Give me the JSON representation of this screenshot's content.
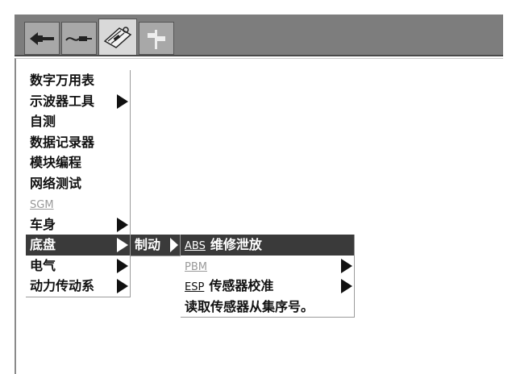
{
  "toolbar": {
    "tabs": [
      {
        "icon": "plug-connector-icon"
      },
      {
        "icon": "probe-cable-icon"
      },
      {
        "icon": "toolbox-wrench-icon",
        "active": true
      },
      {
        "icon": "signpost-icon"
      }
    ]
  },
  "main_menu": {
    "items": [
      {
        "label": "数字万用表"
      },
      {
        "label": "示波器工具"
      },
      {
        "label": "自测"
      },
      {
        "label": "数据记录器"
      },
      {
        "label": "模块编程"
      },
      {
        "label": "网络测试"
      },
      {
        "label": "SGM"
      },
      {
        "label": "车身"
      },
      {
        "label": "底盘"
      },
      {
        "label": "电气"
      },
      {
        "label": "动力传动系"
      }
    ]
  },
  "submenu_chassis": {
    "items": [
      {
        "label": "制动"
      }
    ]
  },
  "submenu_brake": {
    "items": [
      {
        "prefix": "ABS",
        "label": "维修泄放"
      },
      {
        "label": "PBM"
      },
      {
        "prefix": "ESP",
        "label": "传感器校准"
      },
      {
        "label": "读取传感器从集序号。"
      }
    ]
  }
}
